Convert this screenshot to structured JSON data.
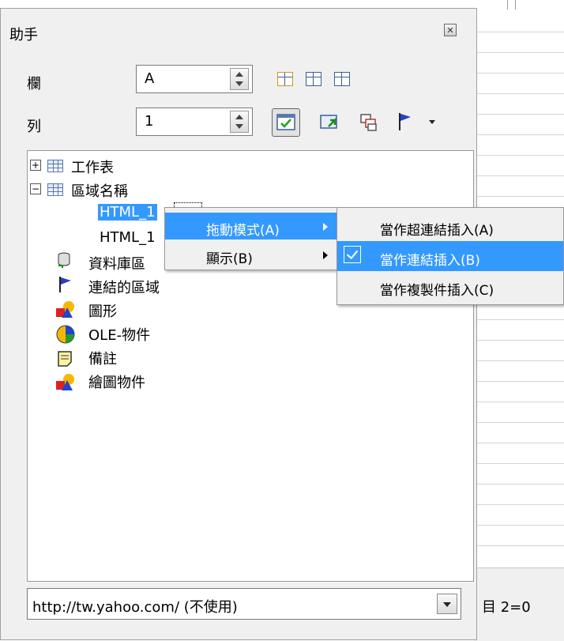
{
  "panel": {
    "title": "助手",
    "close_icon": "close-icon",
    "column_label": "欄",
    "column_value": "A",
    "row_label": "列",
    "row_value": "1"
  },
  "toolbar": {
    "icons": [
      "data-range-icon",
      "start-icon",
      "end-icon",
      "contents-icon",
      "toggle-icon",
      "scenarios-icon",
      "drag-mode-icon",
      "dropdown-arrow-icon"
    ]
  },
  "tree": {
    "items": [
      {
        "label": "工作表",
        "expander": "+",
        "icon": "table-icon"
      },
      {
        "label": "區域名稱",
        "expander": "−",
        "icon": "table-icon"
      },
      {
        "label": "HTML_1",
        "selected": true
      },
      {
        "label": "HTML_1"
      },
      {
        "label": "資料庫區",
        "icon": "database-icon"
      },
      {
        "label": "連結的區域",
        "icon": "flag-icon"
      },
      {
        "label": "圖形",
        "icon": "shapes-icon"
      },
      {
        "label": "OLE-物件",
        "icon": "ole-object-icon"
      },
      {
        "label": "備註",
        "icon": "note-icon"
      },
      {
        "label": "繪圖物件",
        "icon": "drawing-object-icon"
      }
    ]
  },
  "document_combo": {
    "value": "http://tw.yahoo.com/ (不使用)"
  },
  "context_menu": {
    "items": [
      {
        "label": "拖動模式(A)",
        "has_submenu": true,
        "highlighted": true
      },
      {
        "label": "顯示(B)",
        "has_submenu": true
      }
    ]
  },
  "submenu": {
    "items": [
      {
        "label": "當作超連結插入(A)"
      },
      {
        "label": "當作連結插入(B)",
        "checked": true,
        "highlighted": true
      },
      {
        "label": "當作複製件插入(C)"
      }
    ]
  },
  "background": {
    "status_text": "目 2=0"
  },
  "colors": {
    "selection": "#3399ff",
    "panel": "#f0f0f0"
  }
}
